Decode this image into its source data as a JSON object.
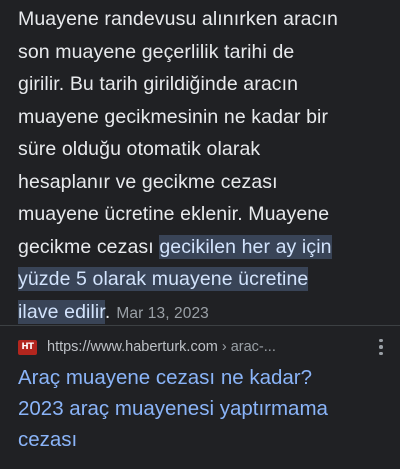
{
  "snippet": {
    "lines": [
      "Muayene randevusu alınırken aracın",
      "son muayene geçerlilik tarihi de",
      "girilir. Bu tarih girildiğinde aracın",
      "muayene gecikmesinin ne kadar bir",
      "süre olduğu otomatik olarak",
      "hesaplanır ve gecikme cezası",
      "muayene ücretine eklenir. Muayene",
      "gecikme cezası "
    ],
    "highlight_lines": [
      "gecikilen her ay için",
      "yüzde 5 olarak muayene ücretine",
      "ilave edilir"
    ],
    "after_highlight": ".",
    "date": "Mar 13, 2023"
  },
  "source": {
    "favicon_text": "HT",
    "url": "https://www.haberturk.com",
    "breadcrumb": " › arac-...",
    "more_icon": "more-vert-icon"
  },
  "result": {
    "title_lines": [
      "Araç muayene cezası ne kadar?",
      "2023 araç muayenesi yaptırmama",
      "cezası"
    ]
  },
  "colors": {
    "background": "#202124",
    "text": "#e8eaed",
    "highlight_bg": "#394457",
    "link": "#8ab4f8",
    "muted": "#9aa0a6"
  }
}
